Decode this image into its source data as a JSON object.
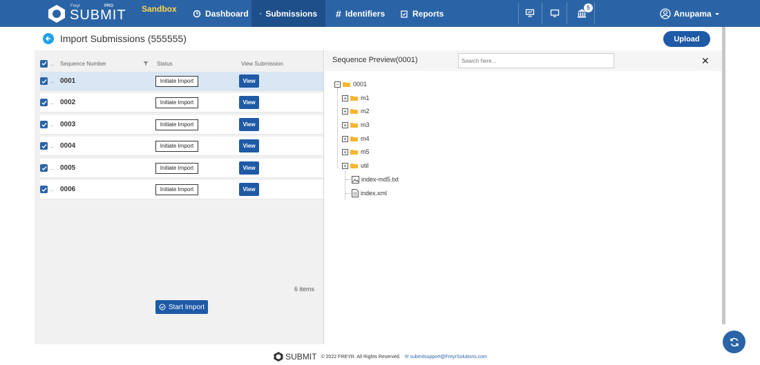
{
  "header": {
    "brand_small": "Freyr",
    "brand": "SUBMIT",
    "brand_pro": "PRO",
    "environment": "Sandbox",
    "nav": [
      {
        "label": "Dashboard",
        "icon": "dashboard-icon"
      },
      {
        "label": "Submissions",
        "icon": "submissions-icon",
        "active": true
      },
      {
        "label": "Identifiers",
        "icon": "hash-icon"
      },
      {
        "label": "Reports",
        "icon": "reports-icon"
      }
    ],
    "notification_count": "5",
    "user_name": "Anupama"
  },
  "page": {
    "title": "Import Submissions (555555)",
    "upload_label": "Upload"
  },
  "grid": {
    "columns": {
      "sequence": "Sequence Number",
      "status": "Status",
      "view": "View Submission",
      "dots": ".."
    },
    "rows": [
      {
        "sequence": "0001",
        "status": "Initiate Import",
        "view": "View",
        "selected": true
      },
      {
        "sequence": "0002",
        "status": "Initiate Import",
        "view": "View"
      },
      {
        "sequence": "0003",
        "status": "Initiate Import",
        "view": "View"
      },
      {
        "sequence": "0004",
        "status": "Initiate Import",
        "view": "View"
      },
      {
        "sequence": "0005",
        "status": "Initiate Import",
        "view": "View"
      },
      {
        "sequence": "0006",
        "status": "Initiate Import",
        "view": "View"
      }
    ],
    "items_count": "6 items",
    "start_import_label": "Start Import"
  },
  "preview": {
    "title": "Sequence Preview(0001)",
    "search_placeholder": "Search here...",
    "tree": {
      "root": "0001",
      "folders": [
        "m1",
        "m2",
        "m3",
        "m4",
        "m5",
        "util"
      ],
      "files": [
        "index-md5.txt",
        "index.xml"
      ]
    }
  },
  "footer": {
    "brand": "SUBMIT",
    "copyright": "© 2022 FREYR. All Rights Reserved.",
    "email": "submitsupport@FreyrSolutions.com"
  },
  "colors": {
    "primary": "#2b64a6",
    "accent": "#1ea0e8",
    "folder": "#f5b731",
    "sandbox": "#ffd34a"
  }
}
